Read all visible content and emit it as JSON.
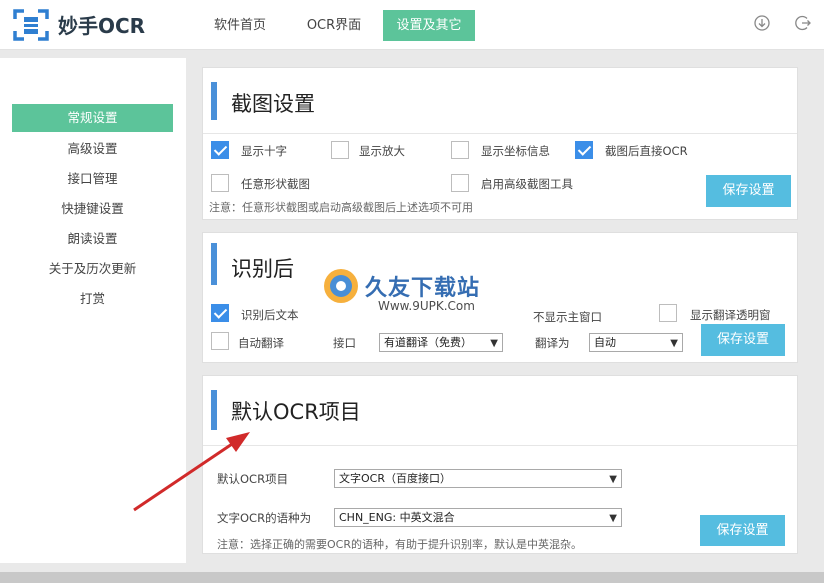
{
  "header": {
    "app_title": "妙手OCR",
    "tabs": [
      {
        "label": "软件首页"
      },
      {
        "label": "OCR界面"
      },
      {
        "label": "设置及其它"
      }
    ]
  },
  "sidebar": {
    "items": [
      {
        "label": "常规设置"
      },
      {
        "label": "高级设置"
      },
      {
        "label": "接口管理"
      },
      {
        "label": "快捷键设置"
      },
      {
        "label": "朗读设置"
      },
      {
        "label": "关于及历次更新"
      },
      {
        "label": "打赏"
      }
    ]
  },
  "screenshot_panel": {
    "title": "截图设置",
    "options": [
      {
        "label": "显示十字",
        "checked": true
      },
      {
        "label": "显示放大",
        "checked": false
      },
      {
        "label": "显示坐标信息",
        "checked": false
      },
      {
        "label": "截图后直接OCR",
        "checked": true
      },
      {
        "label": "任意形状截图",
        "checked": false
      },
      {
        "label": "启用高级截图工具",
        "checked": false
      }
    ],
    "note": "注意：任意形状截图或启动高级截图后上述选项不可用",
    "save_label": "保存设置"
  },
  "after_panel": {
    "title": "识别后",
    "options": [
      {
        "label": "识别后文本",
        "checked": true
      },
      {
        "label": "不显示主窗口",
        "checked": false
      },
      {
        "label": "显示翻译透明窗",
        "checked": false
      },
      {
        "label": "自动翻译",
        "checked": false
      }
    ],
    "interface_label": "接口",
    "interface_value": "有道翻译（免费）",
    "translate_to_label": "翻译为",
    "translate_to_value": "自动",
    "save_label": "保存设置"
  },
  "ocr_panel": {
    "title": "默认OCR项目",
    "default_label": "默认OCR项目",
    "default_value": "文字OCR（百度接口）",
    "lang_label": "文字OCR的语种为",
    "lang_value": "CHN_ENG: 中英文混合",
    "note": "注意：选择正确的需要OCR的语种，有助于提升识别率，默认是中英混杂。",
    "save_label": "保存设置"
  },
  "watermark": {
    "text": "久友下载站",
    "url": "Www.9UPK.Com"
  },
  "colors": {
    "accent_green": "#5cc49a",
    "accent_blue": "#4a90d9",
    "button_blue": "#55bde0",
    "arrow_red": "#d12a2a"
  }
}
